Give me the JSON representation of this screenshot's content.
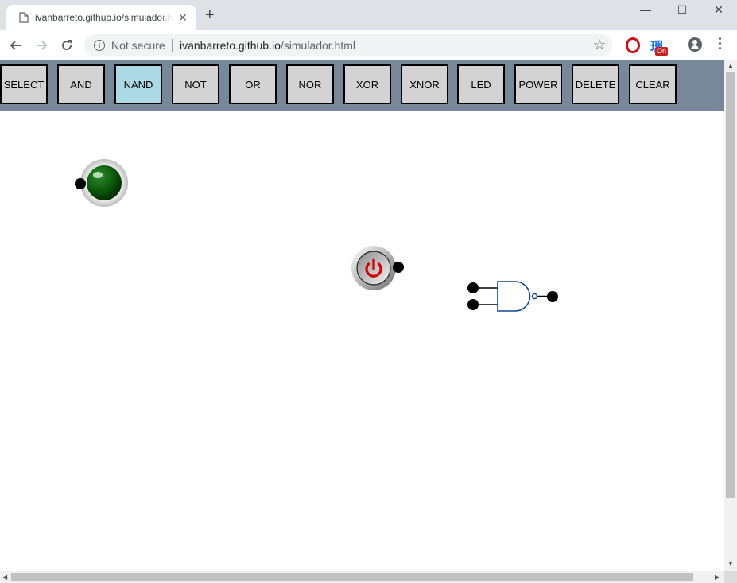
{
  "browser": {
    "tab_title": "ivanbarreto.github.io/simulador.html",
    "tab_close": "✕",
    "new_tab": "+",
    "window_controls": {
      "minimize": "—",
      "maximize": "☐",
      "close": "✕"
    },
    "security_label": "Not secure",
    "url_host": "ivanbarreto.github.io",
    "url_path": "/simulador.html",
    "extension_badge": "On",
    "extension_glyph": "理",
    "star_glyph": "☆",
    "info_glyph": "i"
  },
  "gate_bar": {
    "buttons": [
      {
        "label": "SELECT",
        "active": false
      },
      {
        "label": "AND",
        "active": false
      },
      {
        "label": "NAND",
        "active": true
      },
      {
        "label": "NOT",
        "active": false
      },
      {
        "label": "OR",
        "active": false
      },
      {
        "label": "NOR",
        "active": false
      },
      {
        "label": "XOR",
        "active": false
      },
      {
        "label": "XNOR",
        "active": false
      },
      {
        "label": "LED",
        "active": false
      },
      {
        "label": "POWER",
        "active": false
      },
      {
        "label": "DELETE",
        "active": false
      },
      {
        "label": "CLEAR",
        "active": false
      }
    ]
  },
  "canvas": {
    "components": [
      {
        "type": "led",
        "state": "off",
        "color": "#006400"
      },
      {
        "type": "power",
        "icon": "power-icon",
        "color": "#d40000"
      },
      {
        "type": "nand-gate",
        "stroke": "#0d47a1"
      }
    ]
  },
  "colors": {
    "bar_background": "#778899",
    "button_background": "#d3d3d3",
    "active_button": "#add8e6"
  }
}
